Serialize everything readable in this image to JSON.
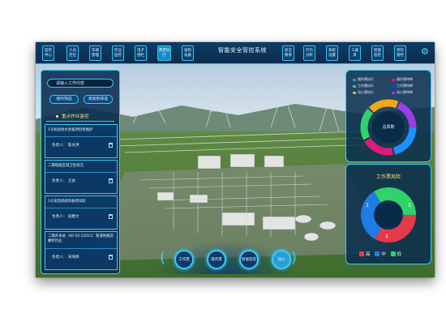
{
  "header": {
    "title": "智能安全管控系统",
    "nav_left": [
      {
        "label": "监控中心",
        "active": false
      },
      {
        "label": "人员定位",
        "active": false
      },
      {
        "label": "车辆管理",
        "active": false
      },
      {
        "label": "作业监控",
        "active": false
      },
      {
        "label": "电子围栏",
        "active": false
      },
      {
        "label": "两票执行",
        "active": true
      },
      {
        "label": "安防设备",
        "active": false
      }
    ],
    "nav_right": [
      {
        "label": "安全教育"
      },
      {
        "label": "行为分析"
      },
      {
        "label": "系统设置"
      },
      {
        "label": "工器具"
      },
      {
        "label": "智能巡检"
      },
      {
        "label": "风险管控"
      }
    ],
    "settings_icon": "gear-icon"
  },
  "left_panel": {
    "search_placeholder": "请输入工作内容",
    "tabs": [
      "按时筛选",
      "按类别筛选"
    ],
    "section_title": "重点作业监控",
    "cards": [
      {
        "title": "1号机组给水泵备用检修维护",
        "person": "负责人：  陈光洪"
      },
      {
        "title": "二期电缆区域卫生保洁",
        "person": "负责人：  王会"
      },
      {
        "title": "1号发电机组热备用试验",
        "person": "负责人：  段爵文"
      },
      {
        "title": "二期开关站（00-50-12021）管道防腐及螺栓作业",
        "person": "负责人：  宋海燕"
      }
    ]
  },
  "right_upper": {
    "center_label": "总票数",
    "legend": [
      {
        "label": "操作票执行",
        "color": "#1e90ff"
      },
      {
        "label": "操作票待审",
        "color": "#e0197a"
      },
      {
        "label": "工作票执行",
        "color": "#2fd36a"
      },
      {
        "label": "工作票待审",
        "color": "#1a3cff"
      },
      {
        "label": "动火票执行",
        "color": "#f0a81c"
      },
      {
        "label": "动火票待审",
        "color": "#9b3ce6"
      }
    ],
    "donut_colors": [
      "#1e90ff",
      "#e0197a",
      "#2fd36a",
      "#f0a81c",
      "#9b3ce6"
    ]
  },
  "right_lower": {
    "title": "工作票风险",
    "values": [
      "1",
      "1",
      "1"
    ],
    "legend": [
      {
        "label": "高",
        "color": "#e53a4a"
      },
      {
        "label": "中",
        "color": "#1e7ce6"
      },
      {
        "label": "低",
        "color": "#2fd36a"
      }
    ]
  },
  "dock": {
    "buttons": [
      {
        "label": "工作票",
        "active": false
      },
      {
        "label": "操作票",
        "active": false
      },
      {
        "label": "智能巡检",
        "active": false
      },
      {
        "label": "动火",
        "active": true
      }
    ]
  }
}
